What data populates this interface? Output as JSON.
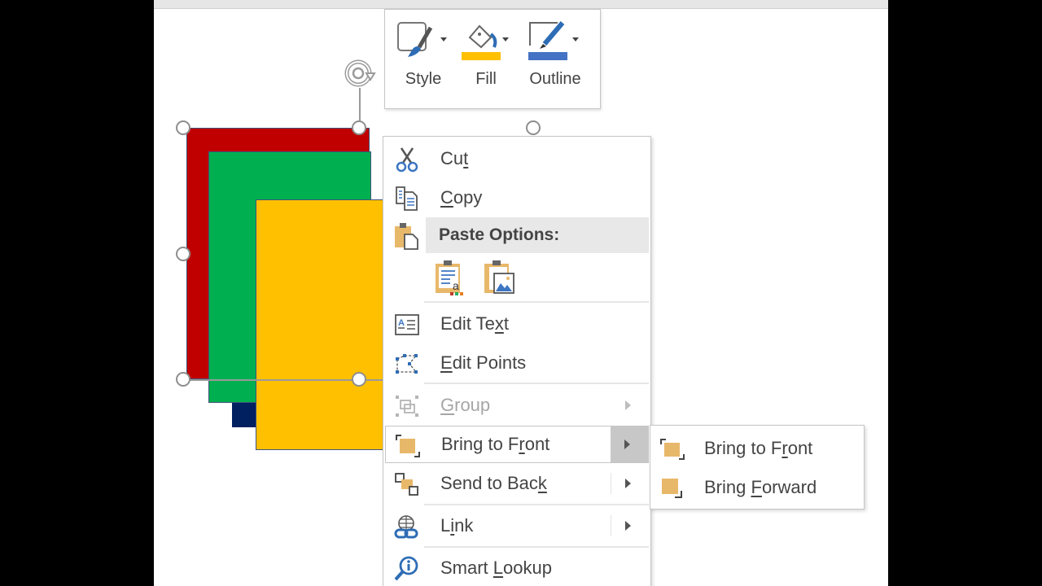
{
  "mini_toolbar": {
    "buttons": [
      {
        "label": "Style",
        "icon": "shape-style-icon"
      },
      {
        "label": "Fill",
        "icon": "paint-bucket-icon",
        "color": "#ffc000"
      },
      {
        "label": "Outline",
        "icon": "pen-outline-icon",
        "color": "#4472c4"
      }
    ]
  },
  "shapes": {
    "colors": {
      "red": "#c00000",
      "green": "#00b050",
      "yellow": "#ffc000",
      "navy": "#002060"
    }
  },
  "context_menu": {
    "items": [
      {
        "label_pre": "Cu",
        "label_ul": "t",
        "label_post": "",
        "icon": "scissors-icon"
      },
      {
        "label_pre": "",
        "label_ul": "C",
        "label_post": "opy",
        "icon": "copy-icon"
      },
      {
        "label": "Paste Options:",
        "icon": "paste-icon"
      },
      {
        "label_pre": "Edit Te",
        "label_ul": "x",
        "label_post": "t",
        "icon": "edit-text-icon"
      },
      {
        "label_pre": "",
        "label_ul": "E",
        "label_post": "dit Points",
        "icon": "edit-points-icon"
      },
      {
        "label_pre": "",
        "label_ul": "G",
        "label_post": "roup",
        "icon": "group-icon",
        "disabled": true,
        "submenu": true
      },
      {
        "label_pre": "Bring to F",
        "label_ul": "r",
        "label_post": "ont",
        "icon": "bring-to-front-icon",
        "submenu": true,
        "highlighted": true
      },
      {
        "label_pre": "Send to Bac",
        "label_ul": "k",
        "label_post": "",
        "icon": "send-to-back-icon",
        "submenu": true
      },
      {
        "label_pre": "L",
        "label_ul": "i",
        "label_post": "nk",
        "icon": "link-icon",
        "submenu": true
      },
      {
        "label_pre": "Smart ",
        "label_ul": "L",
        "label_post": "ookup",
        "icon": "smart-lookup-icon"
      }
    ],
    "paste_options": [
      {
        "name": "keep-text-only",
        "icon": "paste-text-icon"
      },
      {
        "name": "picture",
        "icon": "paste-picture-icon"
      }
    ]
  },
  "submenu": {
    "items": [
      {
        "label_pre": "Bring to F",
        "label_ul": "r",
        "label_post": "ont",
        "icon": "bring-to-front-icon"
      },
      {
        "label_pre": "Bring ",
        "label_ul": "F",
        "label_post": "orward",
        "icon": "bring-forward-icon"
      }
    ]
  }
}
